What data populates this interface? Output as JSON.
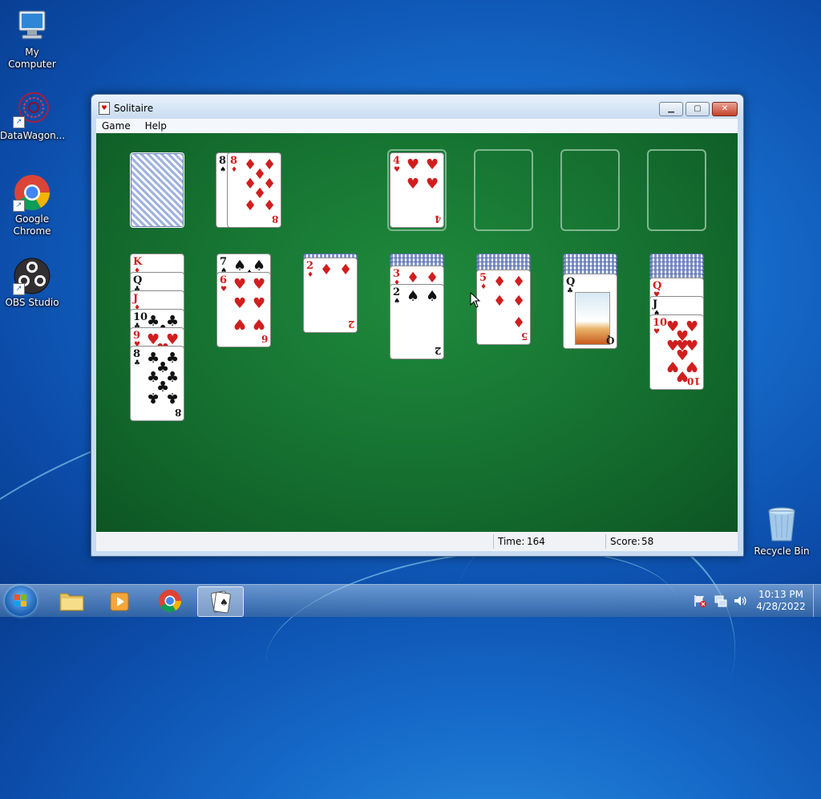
{
  "desktop": {
    "icons": [
      {
        "label": "My Computer"
      },
      {
        "label": "DataWagon..."
      },
      {
        "label": "Google Chrome"
      },
      {
        "label": "OBS Studio"
      },
      {
        "label": "Recycle Bin"
      }
    ]
  },
  "window": {
    "title": "Solitaire",
    "buttons": {
      "minimize": "▁",
      "maximize": "▢",
      "close": "✕"
    },
    "menu": [
      "Game",
      "Help"
    ],
    "status": {
      "time_label": "Time:",
      "time_value": "164",
      "score_label": "Score:",
      "score_value": "58"
    }
  },
  "game": {
    "stock": {
      "face_down": true
    },
    "waste": [
      {
        "rank": "8",
        "suit": "♠",
        "color": "black",
        "partial": true
      },
      {
        "rank": "8",
        "suit": "♦",
        "color": "red"
      }
    ],
    "foundations": [
      {
        "top": {
          "rank": "4",
          "suit": "♥",
          "color": "red"
        }
      },
      {
        "top": null
      },
      {
        "top": null
      },
      {
        "top": null
      }
    ],
    "tableau": [
      {
        "hidden": 0,
        "cards": [
          {
            "rank": "K",
            "suit": "♦",
            "color": "red"
          },
          {
            "rank": "Q",
            "suit": "♣",
            "color": "black"
          },
          {
            "rank": "J",
            "suit": "♦",
            "color": "red"
          },
          {
            "rank": "10",
            "suit": "♣",
            "color": "black"
          },
          {
            "rank": "9",
            "suit": "♥",
            "color": "red"
          },
          {
            "rank": "8",
            "suit": "♣",
            "color": "black"
          }
        ]
      },
      {
        "hidden": 0,
        "cards": [
          {
            "rank": "7",
            "suit": "♠",
            "color": "black"
          },
          {
            "rank": "6",
            "suit": "♥",
            "color": "red"
          }
        ]
      },
      {
        "hidden": 1,
        "cards": [
          {
            "rank": "2",
            "suit": "♦",
            "color": "red"
          }
        ]
      },
      {
        "hidden": 3,
        "cards": [
          {
            "rank": "3",
            "suit": "♦",
            "color": "red"
          },
          {
            "rank": "2",
            "suit": "♠",
            "color": "black"
          }
        ]
      },
      {
        "hidden": 4,
        "cards": [
          {
            "rank": "5",
            "suit": "♦",
            "color": "red"
          }
        ]
      },
      {
        "hidden": 5,
        "cards": [
          {
            "rank": "Q",
            "suit": "♣",
            "color": "black"
          }
        ]
      },
      {
        "hidden": 6,
        "cards": [
          {
            "rank": "Q",
            "suit": "♥",
            "color": "red"
          },
          {
            "rank": "J",
            "suit": "♠",
            "color": "black"
          },
          {
            "rank": "10",
            "suit": "♥",
            "color": "red"
          }
        ]
      }
    ]
  },
  "taskbar": {
    "items": [
      "start-button",
      "file-explorer",
      "media-player",
      "google-chrome",
      "solitaire"
    ],
    "clock": {
      "time": "10:13 PM",
      "date": "4/28/2022"
    }
  }
}
